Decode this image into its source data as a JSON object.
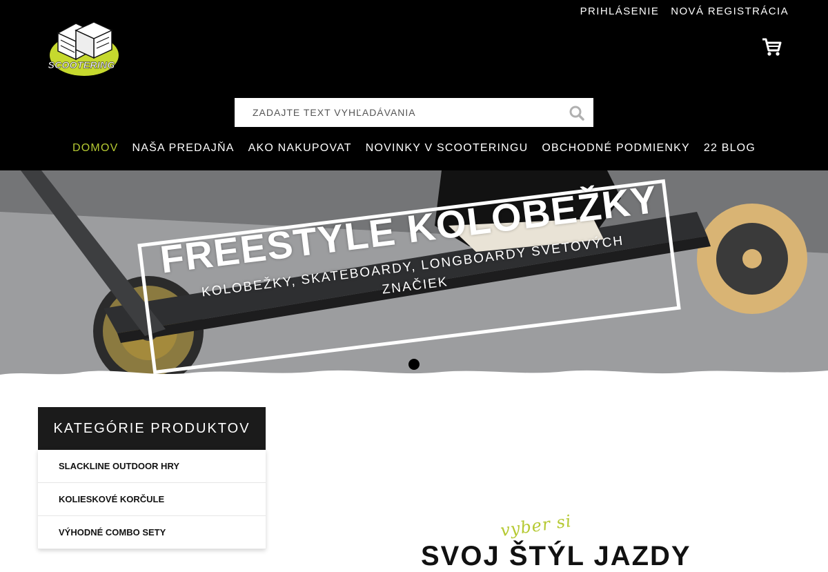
{
  "header": {
    "login_label": "PRIHLÁSENIE",
    "register_label": "NOVÁ REGISTRÁCIA",
    "logo_text": "SCOOTERING",
    "cart_icon": "cart-icon"
  },
  "search": {
    "placeholder": "ZADAJTE TEXT VYHĽADÁVANIA",
    "value": "",
    "icon": "search-icon"
  },
  "nav": {
    "items": [
      {
        "label": "DOMOV",
        "active": true
      },
      {
        "label": "NAŠA PREDAJŇA",
        "active": false
      },
      {
        "label": "AKO NAKUPOVAT",
        "active": false
      },
      {
        "label": "NOVINKY V SCOOTERINGU",
        "active": false
      },
      {
        "label": "OBCHODNÉ PODMIENKY",
        "active": false
      },
      {
        "label": "22 BLOG",
        "active": false
      }
    ]
  },
  "hero": {
    "title": "FREESTYLE KOLOBEŽKY",
    "subtitle": "KOLOBEŽKY, SKATEBOARDY, LONGBOARDY SVETOVÝCH ZNAČIEK"
  },
  "sidebar": {
    "title": "KATEGÓRIE PRODUKTOV",
    "items": [
      {
        "label": "SLACKLINE OUTDOOR HRY"
      },
      {
        "label": "KOLIESKOVÉ KORČULE"
      },
      {
        "label": "VÝHODNÉ COMBO SETY"
      }
    ]
  },
  "section": {
    "script_text": "vyber si",
    "title": "SVOJ ŠTÝL JAZDY"
  },
  "colors": {
    "accent": "#b5c932",
    "header_bg": "#000000",
    "sidebar_header_bg": "#1b1b1b"
  }
}
